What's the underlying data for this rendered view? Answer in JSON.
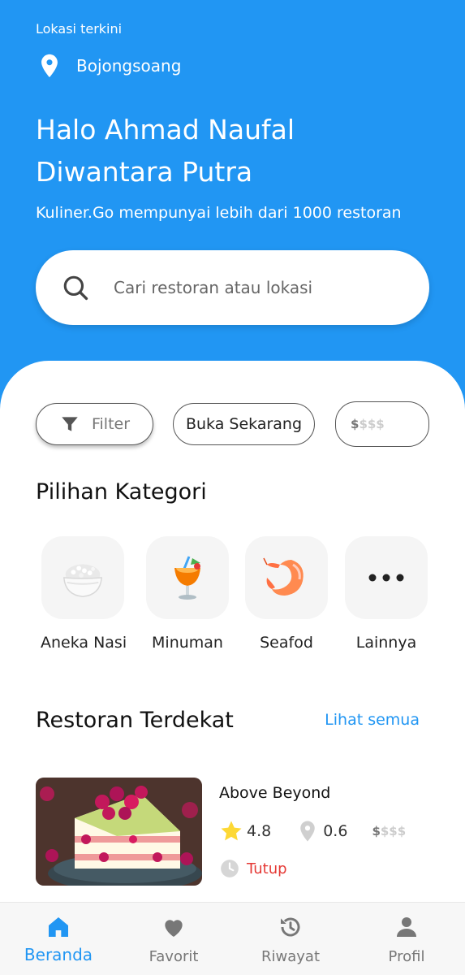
{
  "header": {
    "location_caption": "Lokasi terkini",
    "location_name": "Bojongsoang",
    "greeting": "Halo Ahmad Naufal Diwantara Putra",
    "tagline": "Kuliner.Go mempunyai lebih dari 1000 restoran"
  },
  "search": {
    "placeholder": "Cari restoran atau lokasi"
  },
  "filters": {
    "filter_label": "Filter",
    "open_now_label": "Buka Sekarang",
    "price_active": "$",
    "price_inactive": "$$$"
  },
  "categories": {
    "title": "Pilihan Kategori",
    "items": [
      {
        "label": "Aneka Nasi",
        "icon": "rice-bowl-icon"
      },
      {
        "label": "Minuman",
        "icon": "drink-icon"
      },
      {
        "label": "Seafod",
        "icon": "shrimp-icon"
      },
      {
        "label": "Lainnya",
        "icon": "more-icon"
      }
    ]
  },
  "nearby": {
    "title": "Restoran Terdekat",
    "see_all": "Lihat semua",
    "restaurants": [
      {
        "name": "Above Beyond",
        "rating": "4.8",
        "distance": "0.6",
        "price_active": "$",
        "price_inactive": "$$$",
        "status": "Tutup"
      }
    ]
  },
  "nav": {
    "items": [
      {
        "label": "Beranda",
        "icon": "home-icon",
        "active": true
      },
      {
        "label": "Favorit",
        "icon": "heart-icon",
        "active": false
      },
      {
        "label": "Riwayat",
        "icon": "history-icon",
        "active": false
      },
      {
        "label": "Profil",
        "icon": "profile-icon",
        "active": false
      }
    ]
  },
  "colors": {
    "primary": "#2196F3",
    "closed": "#e53935",
    "star": "#FDD835"
  }
}
